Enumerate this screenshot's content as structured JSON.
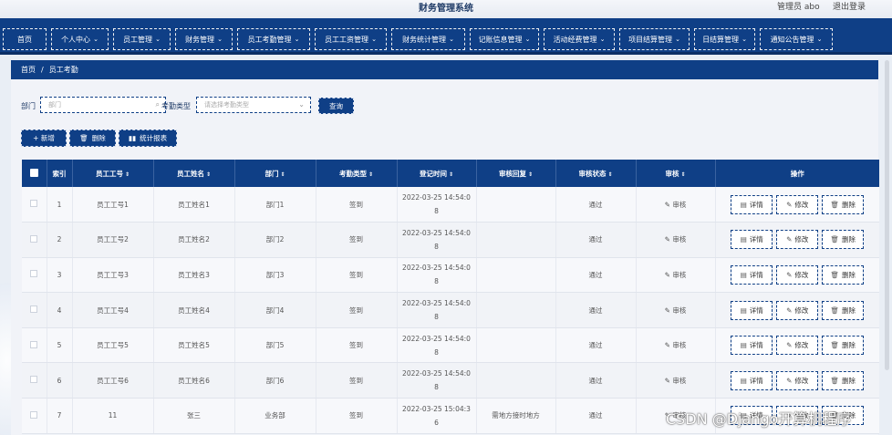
{
  "header": {
    "title": "财务管理系统",
    "admin": "管理员 abo",
    "logout": "退出登录"
  },
  "nav": [
    {
      "label": "首页",
      "caret": false
    },
    {
      "label": "个人中心",
      "caret": true
    },
    {
      "label": "员工管理",
      "caret": true
    },
    {
      "label": "财务管理",
      "caret": true
    },
    {
      "label": "员工考勤管理",
      "caret": true
    },
    {
      "label": "员工工资管理",
      "caret": true
    },
    {
      "label": "财务统计管理",
      "caret": true
    },
    {
      "label": "记账信息管理",
      "caret": true
    },
    {
      "label": "活动经费管理",
      "caret": true
    },
    {
      "label": "项目结算管理",
      "caret": true
    },
    {
      "label": "日结算管理",
      "caret": true
    },
    {
      "label": "通知公告管理",
      "caret": true
    }
  ],
  "breadcrumb": {
    "home": "首页",
    "sep": "/",
    "current": "员工考勤"
  },
  "search": {
    "dept_label": "部门",
    "dept_placeholder": "部门",
    "type_label": "考勤类型",
    "type_placeholder": "请选择考勤类型",
    "query_btn": "查询"
  },
  "actions": {
    "add": "+ 新增",
    "delete": "删除",
    "stats": "统计报表"
  },
  "table": {
    "headers": [
      "索引",
      "员工工号",
      "员工姓名",
      "部门",
      "考勤类型",
      "登记时间",
      "审核回复",
      "审核状态",
      "审核",
      "操作"
    ],
    "audit_label": "审核",
    "op_detail": "详情",
    "op_edit": "修改",
    "op_delete": "删除",
    "rows": [
      {
        "idx": "1",
        "no": "员工工号1",
        "name": "员工姓名1",
        "dept": "部门1",
        "type": "签到",
        "time1": "2022-03-25 14:54:0",
        "time2": "8",
        "reply": "",
        "status": "通过"
      },
      {
        "idx": "2",
        "no": "员工工号2",
        "name": "员工姓名2",
        "dept": "部门2",
        "type": "签到",
        "time1": "2022-03-25 14:54:0",
        "time2": "8",
        "reply": "",
        "status": "通过"
      },
      {
        "idx": "3",
        "no": "员工工号3",
        "name": "员工姓名3",
        "dept": "部门3",
        "type": "签到",
        "time1": "2022-03-25 14:54:0",
        "time2": "8",
        "reply": "",
        "status": "通过"
      },
      {
        "idx": "4",
        "no": "员工工号4",
        "name": "员工姓名4",
        "dept": "部门4",
        "type": "签到",
        "time1": "2022-03-25 14:54:0",
        "time2": "8",
        "reply": "",
        "status": "通过"
      },
      {
        "idx": "5",
        "no": "员工工号5",
        "name": "员工姓名5",
        "dept": "部门5",
        "type": "签到",
        "time1": "2022-03-25 14:54:0",
        "time2": "8",
        "reply": "",
        "status": "通过"
      },
      {
        "idx": "6",
        "no": "员工工号6",
        "name": "员工姓名6",
        "dept": "部门6",
        "type": "签到",
        "time1": "2022-03-25 14:54:0",
        "time2": "8",
        "reply": "",
        "status": "通过"
      },
      {
        "idx": "7",
        "no": "11",
        "name": "张三",
        "dept": "业务部",
        "type": "签到",
        "time1": "2022-03-25 15:04:3",
        "time2": "6",
        "reply": "需地方接时地方",
        "status": "通过"
      }
    ]
  },
  "watermark": "CSDN @Django开算机程序"
}
